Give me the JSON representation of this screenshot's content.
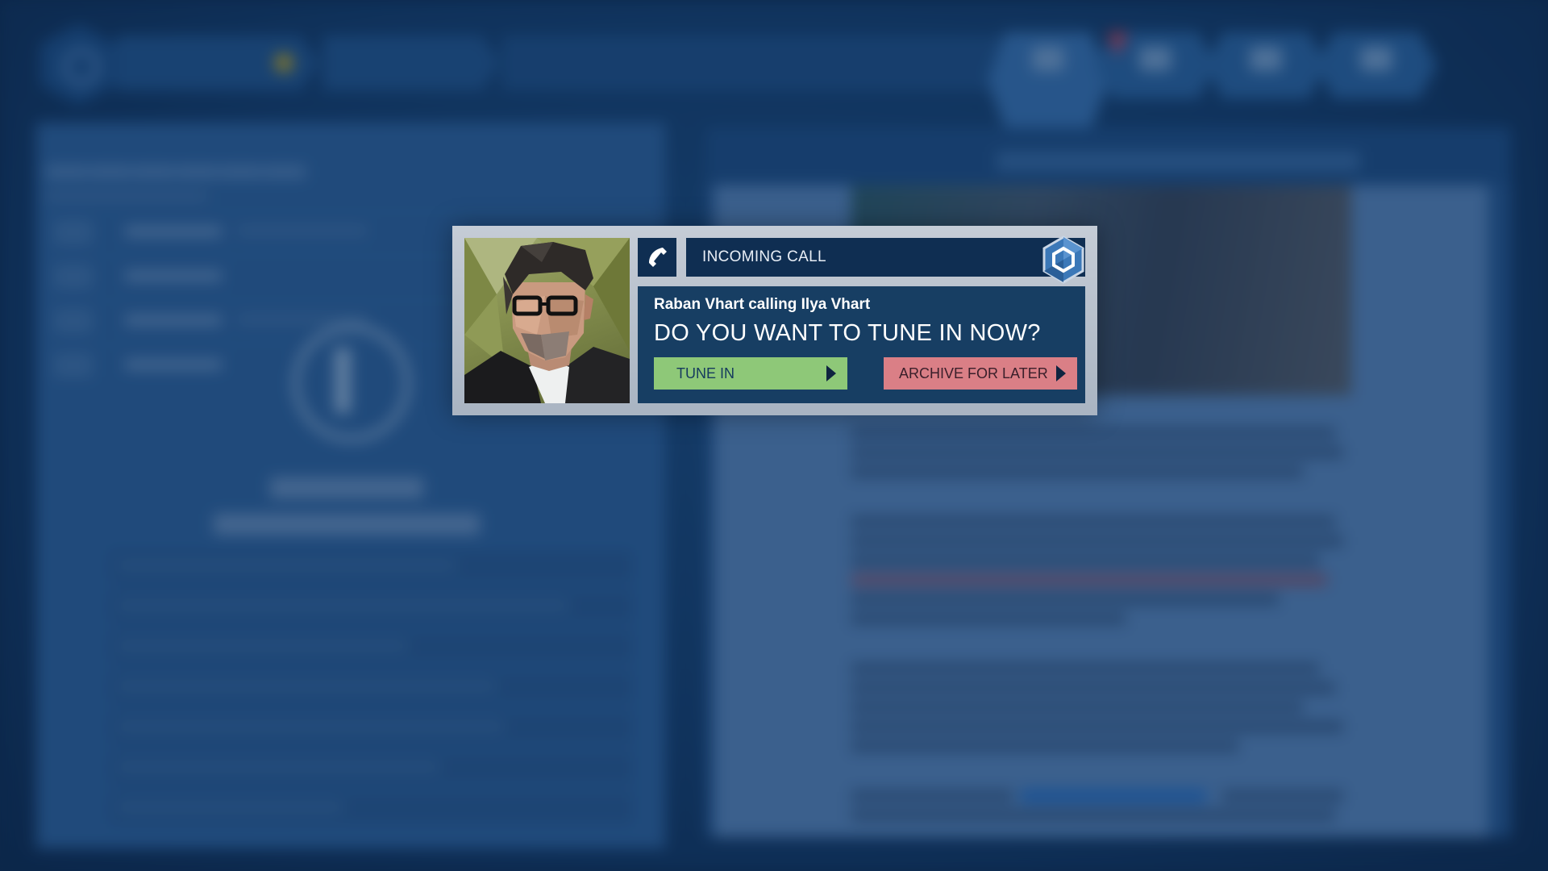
{
  "dialog": {
    "header_title": "INCOMING CALL",
    "caller_line": "Raban Vhart calling Ilya Vhart",
    "question": "DO YOU WANT TO TUNE IN NOW?",
    "buttons": {
      "tune_in": "TUNE IN",
      "archive": "ARCHIVE FOR LATER"
    },
    "icons": {
      "call": "phone-icon",
      "logo": "hexagon-logo-icon",
      "arrow": "play-arrow-icon"
    }
  },
  "colors": {
    "header_bg": "#0f2e52",
    "body_bg": "#173e63",
    "tune_in": "#8ec878",
    "archive": "#da7f86",
    "frame": "#b8c1cc"
  }
}
